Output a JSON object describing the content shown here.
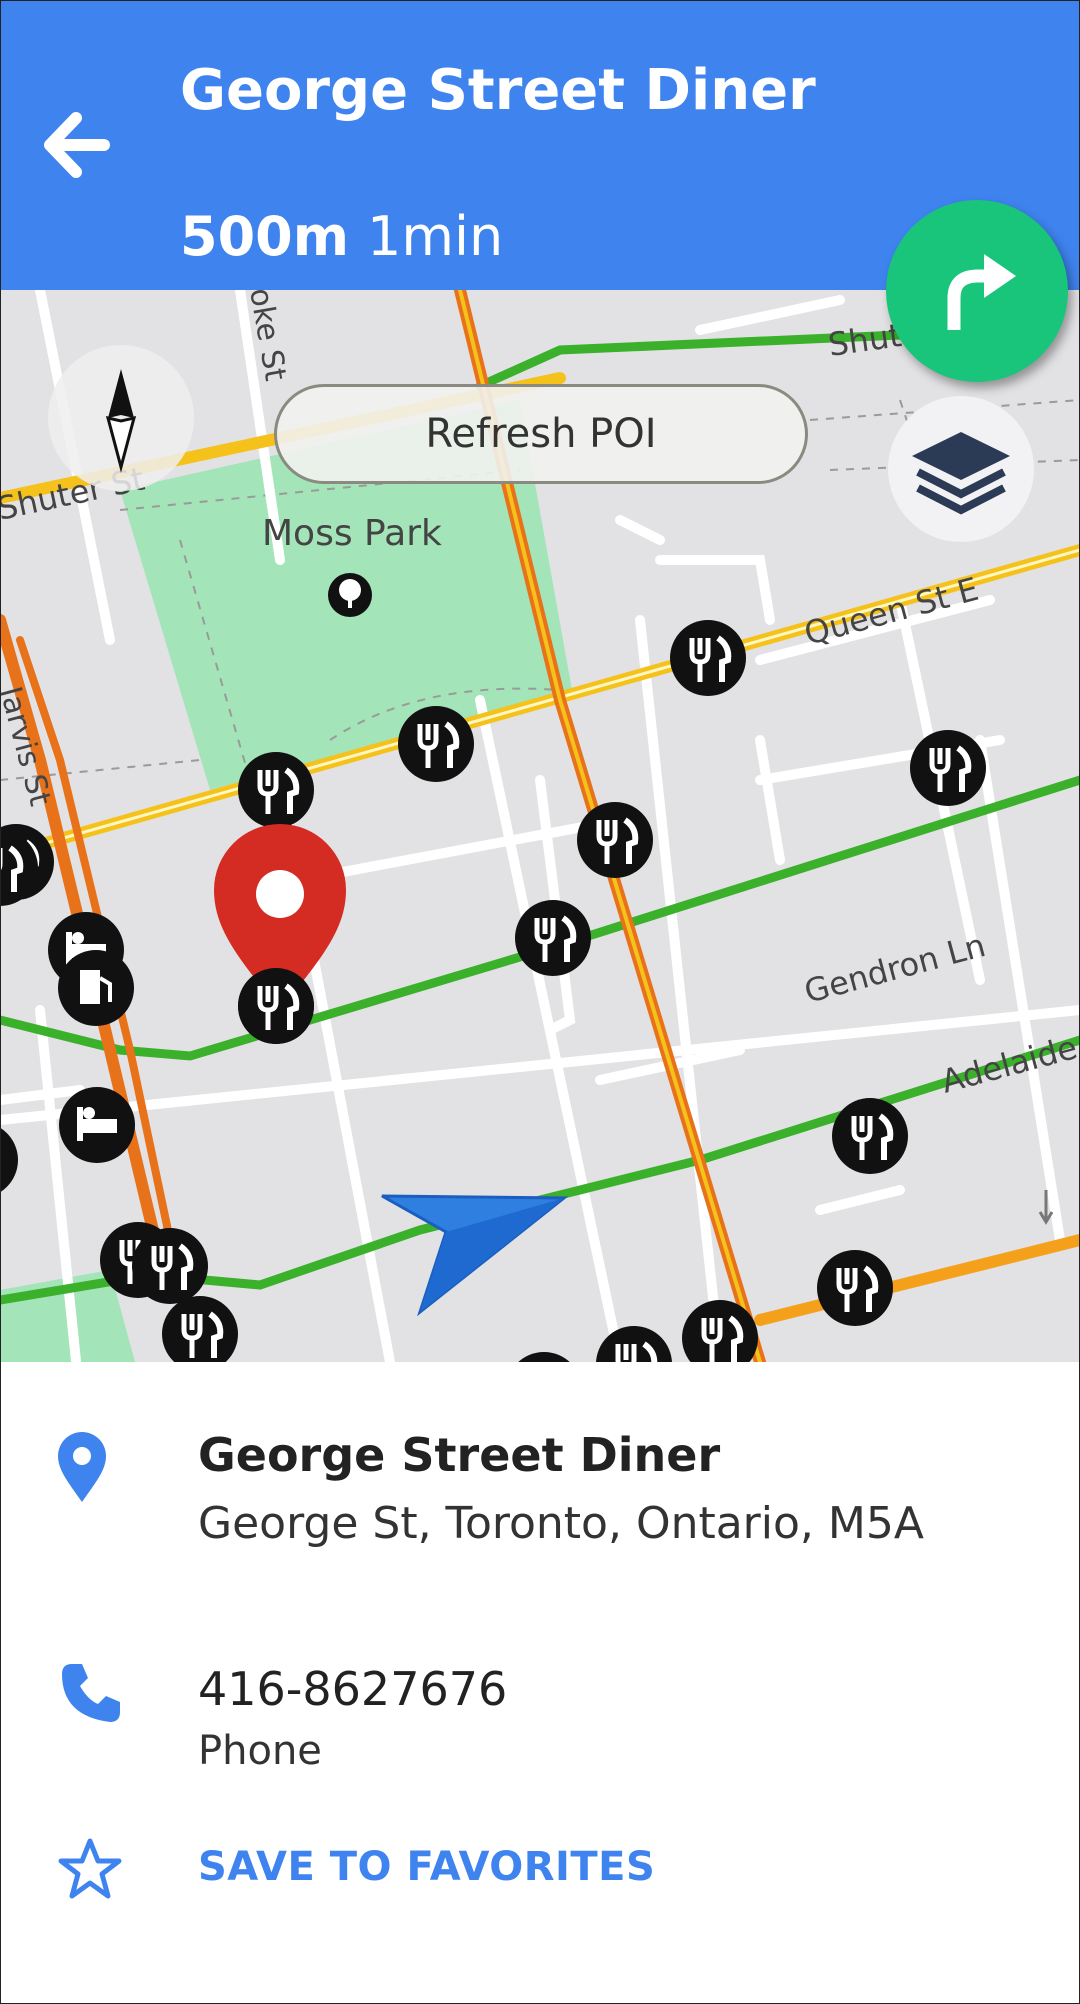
{
  "header": {
    "title": "George Street Diner",
    "distance": "500m",
    "duration": "1min",
    "back_icon": "arrow-left-icon",
    "turn_icon": "turn-right-icon",
    "colors": {
      "header_bg": "#3f83ef",
      "turn_bg": "#19c57b"
    }
  },
  "map": {
    "refresh_label": "Refresh POI",
    "compass_icon": "compass-icon",
    "layers_icon": "layers-icon",
    "street_labels": {
      "shuter_left": "Shuter St",
      "shuter_right": "Shut",
      "moss_park": "Moss Park",
      "queen": "Queen St E",
      "jarvis": "Jarvis St",
      "george": "oke St",
      "gendron": "Gendron Ln",
      "adelaide": "Adelaide"
    }
  },
  "details": {
    "name": "George Street Diner",
    "address": "George St, Toronto, Ontario, M5A",
    "phone": "416-8627676",
    "phone_label": "Phone",
    "save_label": "SAVE TO FAVORITES",
    "location_icon": "location-pin-icon",
    "phone_icon": "phone-icon",
    "star_icon": "star-icon"
  }
}
